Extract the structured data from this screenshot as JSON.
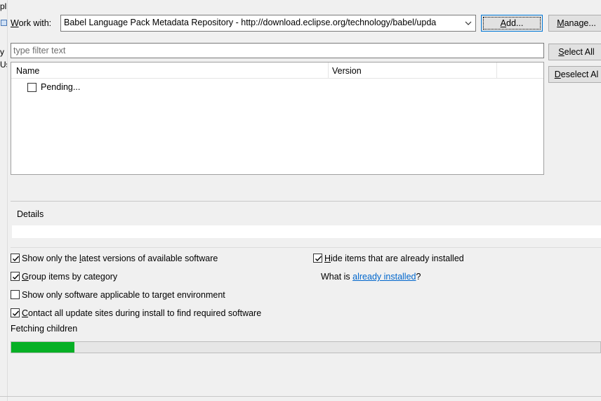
{
  "left_edge": {
    "frag1": "pl",
    "frag2": "y",
    "frag3": "Us"
  },
  "work_with": {
    "label_prefix": "",
    "label_mnemonic": "W",
    "label_rest": "ork with:",
    "value": "Babel Language Pack Metadata Repository - http://download.eclipse.org/technology/babel/upda"
  },
  "buttons": {
    "add": {
      "mnemonic": "A",
      "rest": "dd..."
    },
    "manage": {
      "mnemonic": "M",
      "rest": "anage..."
    },
    "select_all": {
      "mnemonic": "S",
      "rest": "elect All"
    },
    "deselect_all": {
      "mnemonic": "D",
      "rest": "eselect Al"
    }
  },
  "filter": {
    "placeholder": "type filter text"
  },
  "table": {
    "columns": [
      "Name",
      "Version"
    ],
    "rows": [
      {
        "name": "Pending...",
        "checked": false
      }
    ]
  },
  "details": {
    "label": "Details"
  },
  "options": {
    "latest_versions": {
      "checked": true,
      "pre": "Show only the ",
      "mnemonic": "l",
      "post": "atest versions of available software"
    },
    "group_by_category": {
      "checked": true,
      "pre": "",
      "mnemonic": "G",
      "post": "roup items by category"
    },
    "target_env": {
      "checked": false,
      "pre": "Show only software applicable to target environment",
      "mnemonic": "",
      "post": ""
    },
    "contact_sites": {
      "checked": true,
      "pre": "",
      "mnemonic": "C",
      "post": "ontact all update sites during install to find required software"
    },
    "hide_installed": {
      "checked": true,
      "pre": "",
      "mnemonic": "H",
      "post": "ide items that are already installed"
    }
  },
  "what_is": {
    "prefix": "What is ",
    "link": "already installed",
    "suffix": "?"
  },
  "status": {
    "text": "Fetching children"
  },
  "progress": {
    "fraction": 0.107,
    "color": "#06b025"
  }
}
